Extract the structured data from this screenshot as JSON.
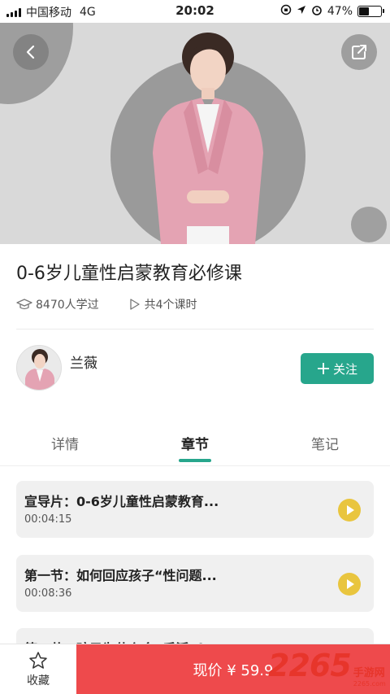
{
  "status_bar": {
    "carrier": "中国移动",
    "network": "4G",
    "time": "20:02",
    "battery": "47%",
    "battery_level": 0.47
  },
  "hero": {
    "back_icon": "chevron-left-icon",
    "share_icon": "share-icon"
  },
  "course": {
    "title": "0-6岁儿童性启蒙教育必修课",
    "learners": "8470人学过",
    "lessons": "共4个课时"
  },
  "teacher": {
    "name": "兰薇",
    "follow_label": "关注"
  },
  "tabs": [
    {
      "label": "详情",
      "active": false
    },
    {
      "label": "章节",
      "active": true
    },
    {
      "label": "笔记",
      "active": false
    }
  ],
  "chapters": [
    {
      "title": "宣导片：0-6岁儿童性启蒙教育...",
      "duration": "00:04:15"
    },
    {
      "title": "第一节：如何回应孩子“性问题...",
      "duration": "00:08:36"
    },
    {
      "title": "第二节：孩子为什么会“手淫”？",
      "duration": ""
    }
  ],
  "bottom_bar": {
    "favorite_label": "收藏",
    "buy_label": "现价 ¥ 59.9"
  },
  "watermark": {
    "number": "2265",
    "text": "手游网",
    "url": "2265.com"
  },
  "colors": {
    "accent": "#27a68c",
    "buy": "#ee4a4c",
    "play": "#e9c53e"
  }
}
